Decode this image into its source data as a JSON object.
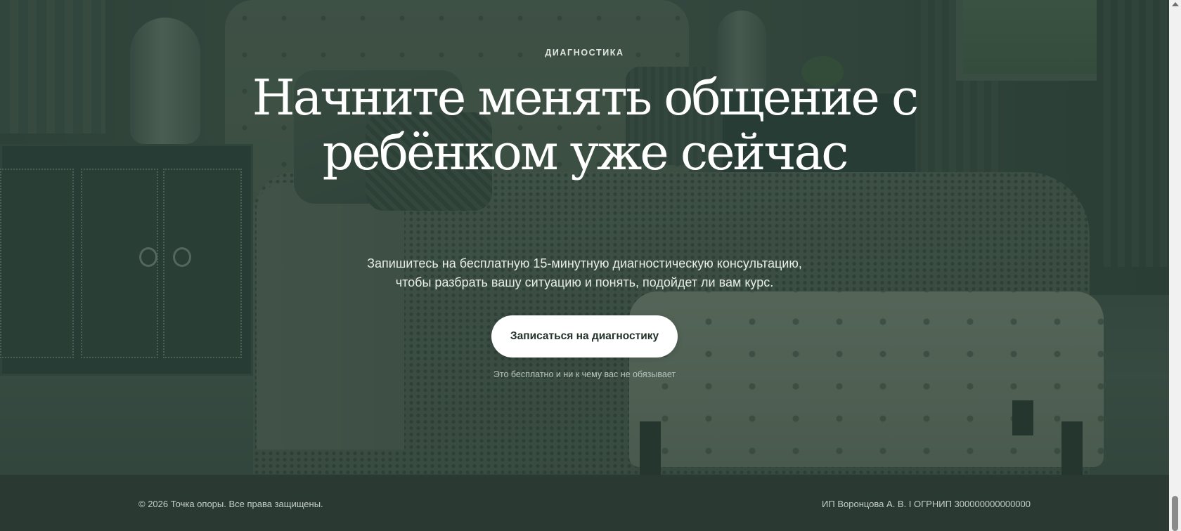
{
  "hero": {
    "eyebrow": "ДИАГНОСТИКА",
    "headline": "Начните менять общение с ребёнком уже сейчас",
    "subtitle_line1": "Запишитесь на бесплатную 15-минутную диагностическую консультацию,",
    "subtitle_line2": "чтобы разбрать вашу ситуацию и понять, подойдет ли вам курс.",
    "cta_label": "Записаться на диагностику",
    "note": "Это бесплатно и ни к чему вас не обязывает",
    "background_image": "bedroom-interior-photo",
    "overlay_color": "#243a30"
  },
  "footer": {
    "copyright": "© 2026 Точка опоры. Все права защищены.",
    "legal": "ИП Воронцова А. В. I ОГРНИП 300000000000000",
    "background_color": "#2a3a33"
  },
  "scrollbar": {
    "up_arrow_icon": "chevron-up-icon"
  }
}
